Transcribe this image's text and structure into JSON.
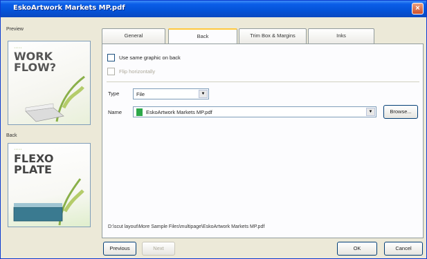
{
  "window": {
    "title": "EskoArtwork Markets MP.pdf",
    "close_label": "×"
  },
  "left": {
    "preview_label": "Preview",
    "back_label": "Back",
    "preview_thumb": {
      "line1": "WORK",
      "line2": "FLOW?"
    },
    "back_thumb": {
      "line1": "FLEXO",
      "line2": "PLATE"
    }
  },
  "tabs": [
    {
      "label": "General"
    },
    {
      "label": "Back"
    },
    {
      "label": "Trim Box & Margins"
    },
    {
      "label": "Inks"
    }
  ],
  "active_tab": "Back",
  "back_tab": {
    "use_same_graphic_label": "Use same graphic on back",
    "use_same_graphic_checked": false,
    "flip_label": "Flip horizontally",
    "flip_checked": false,
    "flip_enabled": false,
    "type_label": "Type",
    "type_value": "File",
    "name_label": "Name",
    "name_value": "EskoArtwork Markets MP.pdf",
    "browse_label": "Browse...",
    "path_text": "D:\\scut layout\\More Sample Files\\multipage\\EskoArtwork Markets MP.pdf"
  },
  "buttons": {
    "previous_label": "Previous",
    "next_label": "Next",
    "ok_label": "OK",
    "cancel_label": "Cancel"
  },
  "colors": {
    "titlebar": "#0453d8",
    "window_bg": "#ece9d8",
    "file_icon": "#2da84a",
    "tab_highlight": "#ffc83c"
  }
}
